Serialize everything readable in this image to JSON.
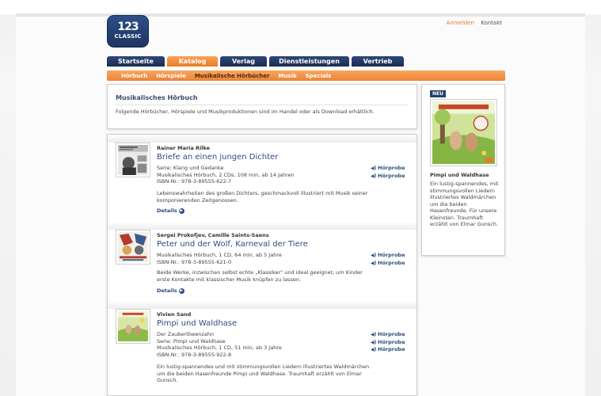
{
  "header": {
    "logo": {
      "number": "123",
      "word": "CLASSIC"
    },
    "login": "Anmelden",
    "contact": "Kontakt"
  },
  "mainnav": [
    {
      "label": "Startseite",
      "active": false
    },
    {
      "label": "Katalog",
      "active": true
    },
    {
      "label": "Verlag",
      "active": false
    },
    {
      "label": "Dienstleistungen",
      "active": false
    },
    {
      "label": "Vertrieb",
      "active": false
    }
  ],
  "subnav": [
    {
      "label": "Hörbuch",
      "active": false
    },
    {
      "label": "Hörspiele",
      "active": false
    },
    {
      "label": "Musikalische Hörbücher",
      "active": true
    },
    {
      "label": "Musik",
      "active": false
    },
    {
      "label": "Specials",
      "active": false
    }
  ],
  "intro": {
    "title": "Musikalisches Hörbuch",
    "text": "Folgende Hörbücher, Hörspiele und Musikproduktionen sind im Handel oder als Download erhältlich."
  },
  "entries": [
    {
      "author": "Rainer Maria Rilke",
      "title": "Briefe an einen jungen Dichter",
      "meta": [
        "Serie: Klang und Gedanke",
        "Musikalisches Hörbuch, 2 CDs, 108 min, ab 14 Jahren",
        "ISBN-Nr.: 978-3-89555-622-7"
      ],
      "desc": "Lebenswahrheiten des großen Dichters, geschmackvoll illustriert mit Musik seiner komponierenden Zeitgenossen.",
      "details": "Details",
      "probes": [
        "Hörprobe",
        "Hörprobe"
      ]
    },
    {
      "author": "Sergei Prokofjev, Camille Saints-Saens",
      "title": "Peter und der Wolf, Karneval der Tiere",
      "meta": [
        "Musikalisches Hörbuch, 1 CD, 64 min, ab 5 Jahre",
        "ISBN-Nr.: 978-3-89555-621-0"
      ],
      "desc": "Beide Werke, inzwischen selbst echte „Klassiker\" und ideal geeignet, um Kinder erste Kontakte mit klassischer Musik knüpfen zu lassen.",
      "details": "Details",
      "probes": [
        "Hörprobe",
        "Hörprobe"
      ]
    },
    {
      "author": "Vivien Sand",
      "title": "Pimpi und Waldhase",
      "meta": [
        "Der Zauberlöwenzahn",
        "Serie: Pimpi und Waldhase",
        "Musikalisches Hörbuch, 1 CD, 51 min, ab 3 Jahre",
        "ISBN-Nr.: 978-3-89555-922-8"
      ],
      "desc": "Ein lustig-spannendes und mit stimmungsvollen Liedern illustriertes Waldmärchen um die beiden Hasenfreunde Pimpi und Waldhase. Traumhaft erzählt von Elmar Gunsch.",
      "details": "",
      "probes": [
        "Hörprobe",
        "Hörprobe",
        "Hörprobe"
      ]
    }
  ],
  "side": {
    "badge": "NEU",
    "title": "Pimpi und Waldhase",
    "text": "Ein lustig-spannendes, mit stimmungsvollen Liedern illustriertes Waldmärchen um die beiden Hasenfreunde. Für unsere Kleinsten. Traumhaft erzählt von Elmar Gunsch."
  },
  "colors": {
    "navy": "#1d3564",
    "orange": "#ee8232",
    "link": "#2c4d7e"
  }
}
